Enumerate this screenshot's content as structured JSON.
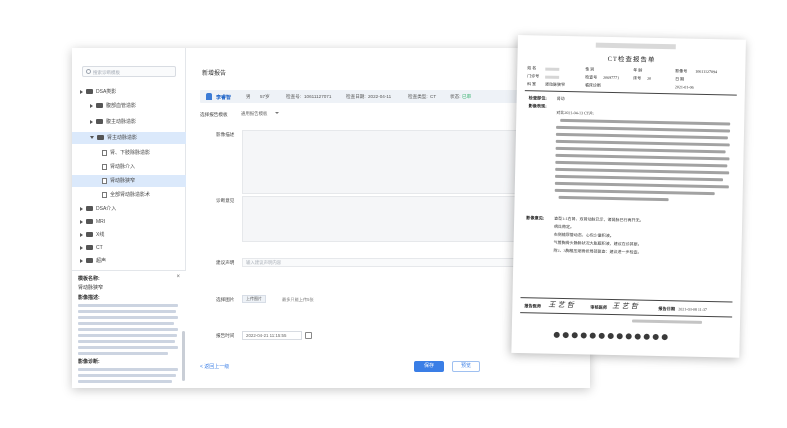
{
  "app": {
    "search_placeholder": "搜索诊断模板",
    "page_title": "新增报告",
    "tree": {
      "dsa_root": "DSA类影",
      "abdomen": "腹部血管造影",
      "abdomen_arteries": "腹主动脉造影",
      "sel_parent": "肾主动脉造影",
      "doc1": "肾、下肢除脉造影",
      "doc2": "肾动脉介入",
      "doc3": "肾动脉狭窄",
      "doc4": "全部肾动脉造影术",
      "n1": "DSA介入",
      "n2": "MRI",
      "n3": "X线",
      "n4": "CT",
      "n5": "超声"
    },
    "hint": {
      "title": "模板名称:",
      "subtitle": "肾动脉狭窄",
      "desc_title": "影像描述:",
      "diag_title": "影像诊断:"
    },
    "patient": {
      "name": "李睿智",
      "gender": "男",
      "age": "57岁",
      "exam_no_label": "检查号:",
      "exam_no": "10611127071",
      "exam_date_label": "检查日期:",
      "exam_date": "2022-04-11",
      "modality_label": "检查类型:",
      "modality": "CT",
      "status_label": "状态:",
      "status": "已审"
    },
    "form": {
      "template_label": "选择报告模板",
      "template_value": "通用报告模板",
      "desc_label": "影像描述",
      "diag_label": "诊断意见",
      "remark_label": "建议声明",
      "remark_placeholder": "输入建议声明内容",
      "image_label": "选择图片",
      "upload_btn": "上传图片",
      "upload_hint": "最多只能上传5张",
      "time_label": "报告时间",
      "time_value": "2022-04-21 11:15:55"
    },
    "actions": {
      "back": "< 返回上一级",
      "save": "保存",
      "preview": "预览"
    }
  },
  "report": {
    "title": "CT检查报告单",
    "fields": {
      "name_label": "姓 名",
      "gender_label": "性 别",
      "age_label": "年 龄",
      "reg_label": "影像号",
      "reg_value": "10611127094",
      "clinic_label": "门诊号",
      "exam_label": "检查号",
      "exam_value": "20697771",
      "bed_label": "床号",
      "bed_value": "20",
      "date_label": "日 期",
      "dept_label": "科 室",
      "dept_value": "2021-01-06",
      "diag_label": "临床诊断",
      "diag_value": "肾动脉狭窄"
    },
    "sec_part_label": "检查部位:",
    "sec_part_value": "肾动",
    "sec_desc_label": "影像表现:",
    "sec_desc_first": "对比2021-04-13 CT片:",
    "sec_diag_label": "影像意见:",
    "diag_lines": [
      "查型1-1右肾、双肾动脉已示，诸肾脉已行再开无。",
      "病灶稳定。",
      "右侧输尿管动态，心包少量积液。",
      "气管胸骨头静脉状况大胀膜积液，建议在诊其断。",
      "附2、3胸椎压缩骨折局部复查：建议进一步检查。"
    ],
    "report_doc_label": "报告医师",
    "audit_doc_label": "审核医师",
    "sig1": "王 艺 哲",
    "sig2": "王 艺 哲",
    "report_date_label": "报告日期",
    "report_date_value": "2021-03-08 11:37"
  }
}
